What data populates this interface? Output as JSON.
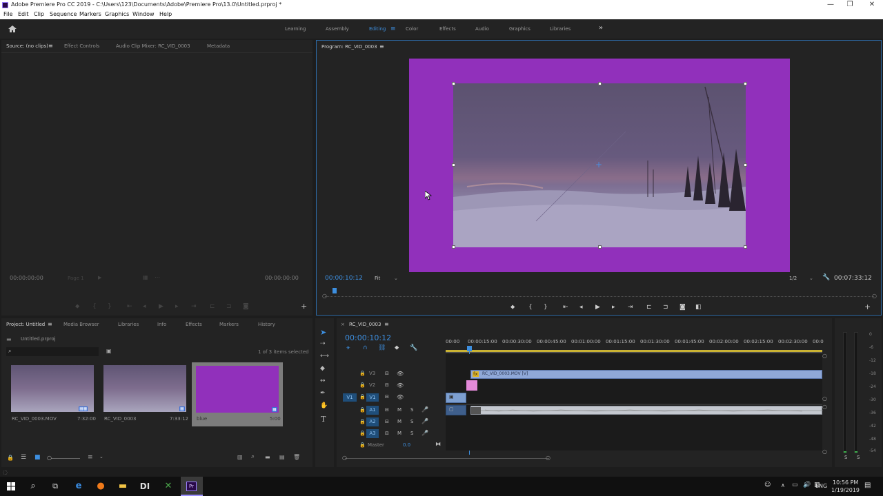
{
  "window": {
    "title": "Adobe Premiere Pro CC 2019 - C:\\Users\\123\\Documents\\Adobe\\Premiere Pro\\13.0\\Untitled.prproj *",
    "minimize": "—",
    "maximize": "❐",
    "close": "✕"
  },
  "menu": [
    "File",
    "Edit",
    "Clip",
    "Sequence",
    "Markers",
    "Graphics",
    "Window",
    "Help"
  ],
  "workspaces": {
    "items": [
      "Learning",
      "Assembly",
      "Editing",
      "Color",
      "Effects",
      "Audio",
      "Graphics",
      "Libraries"
    ],
    "active": "Editing",
    "more": "»"
  },
  "source_panel": {
    "tabs": [
      "Source: (no clips)",
      "Effect Controls",
      "Audio Clip Mixer: RC_VID_0003",
      "Metadata"
    ],
    "timecode_left": "00:00:00:00",
    "page": "Page 1",
    "timecode_right": "00:00:00:00"
  },
  "program_panel": {
    "tab": "Program: RC_VID_0003",
    "timecode": "00:00:10:12",
    "fit": "Fit",
    "resolution": "1/2",
    "duration": "00:07:33:12",
    "colors": {
      "background": "#9130bb",
      "frame": "#5d5272"
    }
  },
  "project_panel": {
    "tabs": [
      "Project: Untitled",
      "Media Browser",
      "Libraries",
      "Info",
      "Effects",
      "Markers",
      "History"
    ],
    "file": "Untitled.prproj",
    "selection_info": "1 of 3 items selected",
    "items": [
      {
        "name": "RC_VID_0003.MOV",
        "duration": "7:32:00"
      },
      {
        "name": "RC_VID_0003",
        "duration": "7:33:12"
      },
      {
        "name": "blue",
        "duration": "5:00"
      }
    ]
  },
  "timeline": {
    "tab": "RC_VID_0003",
    "timecode": "00:00:10:12",
    "ruler": [
      "00:00",
      "00:00:15:00",
      "00:00:30:00",
      "00:00:45:00",
      "00:01:00:00",
      "00:01:15:00",
      "00:01:30:00",
      "00:01:45:00",
      "00:02:00:00",
      "00:02:15:00",
      "00:02:30:00",
      "00:0"
    ],
    "video_tracks": [
      "V3",
      "V2",
      "V1"
    ],
    "audio_tracks": [
      "A1",
      "A2",
      "A3"
    ],
    "source_patch": "V1",
    "master": "Master",
    "master_value": "0.0",
    "track_buttons": {
      "mute": "M",
      "solo": "S"
    },
    "clip_label": "RC_VID_0003.MOV [V]"
  },
  "audio_meter": {
    "scale": [
      "0",
      "-6",
      "-12",
      "-18",
      "-24",
      "-30",
      "-36",
      "-42",
      "-48",
      "-54"
    ],
    "solo": [
      "S",
      "S"
    ]
  },
  "taskbar": {
    "lang": "ENG",
    "time": "10:56 PM",
    "date": "1/19/2019"
  }
}
